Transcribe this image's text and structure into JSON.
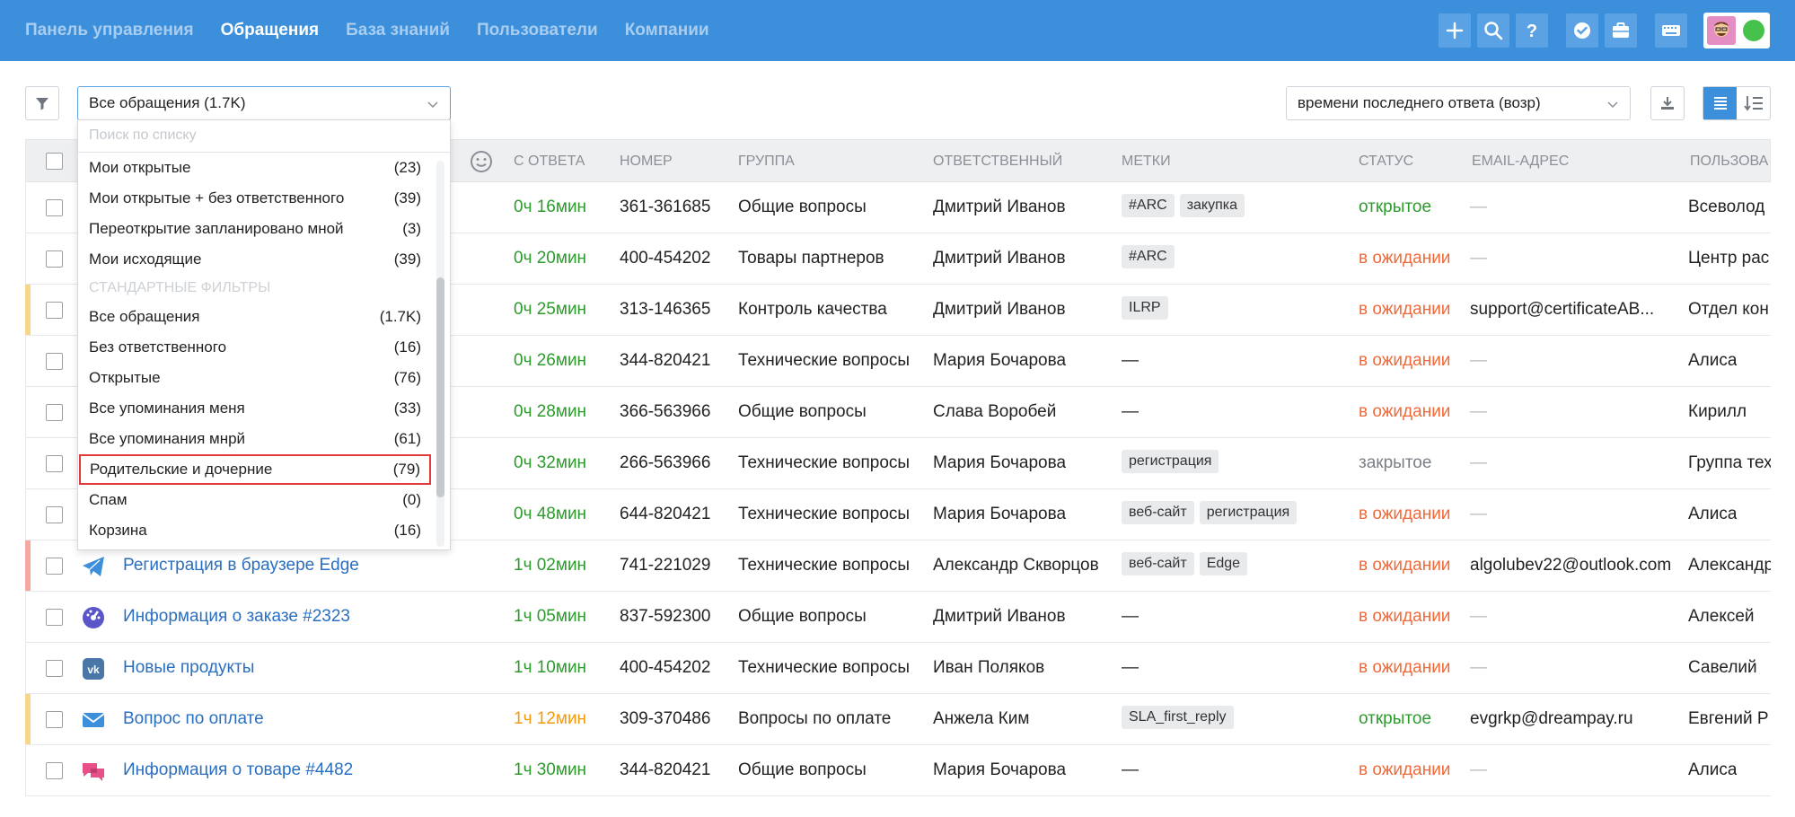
{
  "nav": {
    "items": [
      {
        "label": "Панель управления",
        "active": false
      },
      {
        "label": "Обращения",
        "active": true
      },
      {
        "label": "База знаний",
        "active": false
      },
      {
        "label": "Пользователи",
        "active": false
      },
      {
        "label": "Компании",
        "active": false
      }
    ]
  },
  "toolbar": {
    "view_select": "Все обращения (1.7K)",
    "search_placeholder": "Поиск по списку",
    "sort_select": "времени последнего ответа (возр)"
  },
  "dropdown": {
    "items_top": [
      {
        "label": "Мои открытые",
        "count": "(23)"
      },
      {
        "label": "Мои открытые + без ответственного",
        "count": "(39)"
      },
      {
        "label": "Переоткрытие запланировано мной",
        "count": "(3)"
      },
      {
        "label": "Мои исходящие",
        "count": "(39)"
      }
    ],
    "section_label": "Стандартные фильтры",
    "items_std": [
      {
        "label": "Все обращения",
        "count": "(1.7K)"
      },
      {
        "label": "Без ответственного",
        "count": "(16)"
      },
      {
        "label": "Открытые",
        "count": "(76)"
      },
      {
        "label": "Все упоминания меня",
        "count": "(33)"
      },
      {
        "label": "Все упоминания мнрй",
        "count": "(61)"
      },
      {
        "label": "Родительские и дочерние",
        "count": "(79)"
      },
      {
        "label": "Спам",
        "count": "(0)"
      },
      {
        "label": "Корзина",
        "count": "(16)"
      }
    ]
  },
  "table": {
    "headers": {
      "since_reply": "С ответа",
      "number": "Номер",
      "group": "Группа",
      "assignee": "Ответственный",
      "tags": "Метки",
      "status": "Статус",
      "email": "Email-адрес",
      "user": "Пользова"
    },
    "rows": [
      {
        "stripe": "",
        "icon": "",
        "subject": "",
        "time": "0ч 16мин",
        "time_color": "green",
        "number": "361-361685",
        "group": "Общие вопросы",
        "assignee": "Дмитрий Иванов",
        "tags": [
          "#ARC",
          "закупка"
        ],
        "status": "открытое",
        "status_kind": "open",
        "email": "—",
        "user": "Всеволод"
      },
      {
        "stripe": "",
        "icon": "",
        "subject": "",
        "time": "0ч 20мин",
        "time_color": "green",
        "number": "400-454202",
        "group": "Товары партнеров",
        "assignee": "Дмитрий Иванов",
        "tags": [
          "#ARC"
        ],
        "status": "в ожидании",
        "status_kind": "wait",
        "email": "—",
        "user": "Центр рас"
      },
      {
        "stripe": "#f7d68a",
        "icon": "",
        "subject": "",
        "time": "0ч 25мин",
        "time_color": "green",
        "number": "313-146365",
        "group": "Контроль качества",
        "assignee": "Дмитрий Иванов",
        "tags": [
          "ILRP"
        ],
        "status": "в ожидании",
        "status_kind": "wait",
        "email": "support@certificateAB...",
        "user": "Отдел кон"
      },
      {
        "stripe": "",
        "icon": "",
        "subject": "",
        "time": "0ч 26мин",
        "time_color": "green",
        "number": "344-820421",
        "group": "Технические вопросы",
        "assignee": "Мария Бочарова",
        "tags": [],
        "status": "в ожидании",
        "status_kind": "wait",
        "email": "—",
        "user": "Алиса"
      },
      {
        "stripe": "",
        "icon": "",
        "subject": "",
        "time": "0ч 28мин",
        "time_color": "green",
        "number": "366-563966",
        "group": "Общие вопросы",
        "assignee": "Слава Воробей",
        "tags": [],
        "status": "в ожидании",
        "status_kind": "wait",
        "email": "—",
        "user": "Кирилл"
      },
      {
        "stripe": "",
        "icon": "",
        "subject": "",
        "time": "0ч 32мин",
        "time_color": "green",
        "number": "266-563966",
        "group": "Технические вопросы",
        "assignee": "Мария Бочарова",
        "tags": [
          "регистрация"
        ],
        "status": "закрытое",
        "status_kind": "closed",
        "email": "—",
        "user": "Группа тех"
      },
      {
        "stripe": "",
        "icon": "",
        "subject": "",
        "time": "0ч 48мин",
        "time_color": "green",
        "number": "644-820421",
        "group": "Технические вопросы",
        "assignee": "Мария Бочарова",
        "tags": [
          "веб-сайт",
          "регистрация"
        ],
        "status": "в ожидании",
        "status_kind": "wait",
        "email": "—",
        "user": "Алиса"
      },
      {
        "stripe": "#f4a9a0",
        "icon": "telegram",
        "subject": "Регистрация в браузере Edge",
        "time": "1ч 02мин",
        "time_color": "green",
        "number": "741-221029",
        "group": "Технические вопросы",
        "assignee": "Александр Скворцов",
        "tags": [
          "веб-сайт",
          "Edge"
        ],
        "status": "в ожидании",
        "status_kind": "wait",
        "email": "algolubev22@outlook.com",
        "user": "Александр"
      },
      {
        "stripe": "",
        "icon": "widget",
        "subject": "Информация о заказе #2323",
        "time": "1ч 05мин",
        "time_color": "green",
        "number": "837-592300",
        "group": "Общие вопросы",
        "assignee": "Дмитрий Иванов",
        "tags": [],
        "status": "в ожидании",
        "status_kind": "wait",
        "email": "—",
        "user": "Алексей"
      },
      {
        "stripe": "",
        "icon": "vk",
        "subject": "Новые продукты",
        "time": "1ч 10мин",
        "time_color": "green",
        "number": "400-454202",
        "group": "Технические вопросы",
        "assignee": "Иван Поляков",
        "tags": [],
        "status": "в ожидании",
        "status_kind": "wait",
        "email": "—",
        "user": "Савелий"
      },
      {
        "stripe": "#f7d68a",
        "icon": "email",
        "subject": "Вопрос по оплате",
        "time": "1ч 12мин",
        "time_color": "orange",
        "number": "309-370486",
        "group": "Вопросы по оплате",
        "assignee": "Анжела Ким",
        "tags": [
          "SLA_first_reply"
        ],
        "status": "открытое",
        "status_kind": "open",
        "email": "evgrkp@dreampay.ru",
        "user": "Евгений Р"
      },
      {
        "stripe": "",
        "icon": "chat",
        "subject": "Информация о товаре #4482",
        "time": "1ч 30мин",
        "time_color": "green",
        "number": "344-820421",
        "group": "Общие вопросы",
        "assignee": "Мария Бочарова",
        "tags": [],
        "status": "в ожидании",
        "status_kind": "wait",
        "email": "—",
        "user": "Алиса"
      }
    ],
    "empty_dash": "—"
  },
  "colors": {
    "topbar": "#3c8fda",
    "link": "#2a6fbf",
    "green": "#2e9a2e",
    "orange": "#f39a10",
    "wait": "#ee6a3a",
    "highlight_border": "#e23b3b"
  }
}
